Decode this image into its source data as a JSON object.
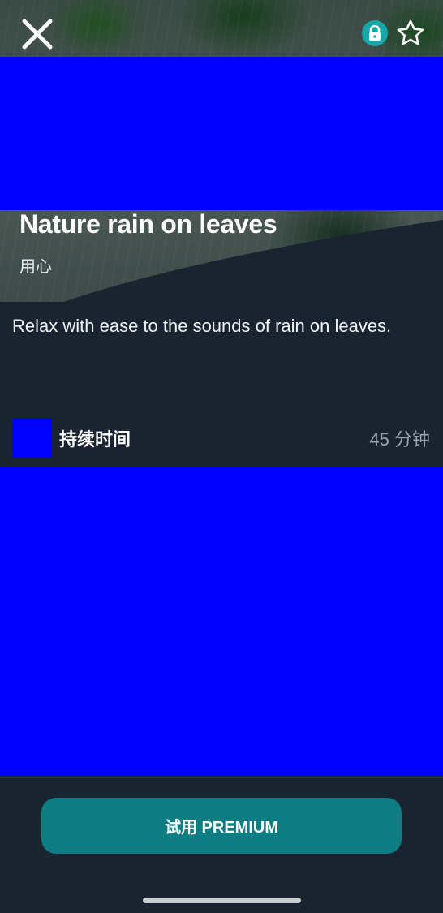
{
  "header": {
    "close_icon": "close-icon",
    "lock_icon": "lock-icon",
    "favorite_icon": "star-outline-icon"
  },
  "track": {
    "title": "Nature rain on leaves",
    "category": "用心",
    "description": "Relax with ease to the sounds of rain on leaves."
  },
  "details": {
    "duration_label": "持续时间",
    "duration_value": "45 分钟"
  },
  "footer": {
    "cta_label": "试用 PREMIUM"
  },
  "colors": {
    "background": "#1a2430",
    "accent": "#0e7d82",
    "lock_badge": "#18a7a9",
    "placeholder_block": "#0000ff"
  }
}
